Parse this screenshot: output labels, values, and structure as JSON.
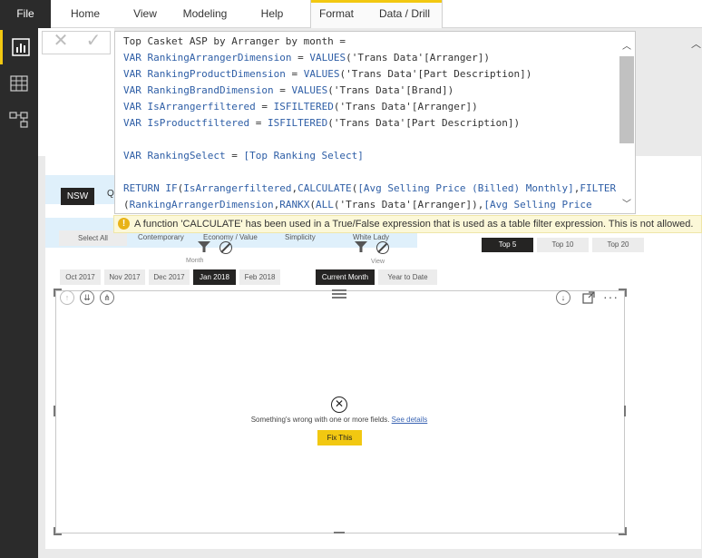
{
  "ribbon": {
    "file": "File",
    "tabs": [
      "Home",
      "View",
      "Modeling",
      "Help",
      "Format",
      "Data / Drill"
    ]
  },
  "formula": {
    "lines": [
      [
        {
          "t": "Top Casket ASP by Arranger by month =",
          "c": "plain"
        }
      ],
      [
        {
          "t": "VAR ",
          "c": "kw"
        },
        {
          "t": "RankingArrangerDimension",
          "c": "kw"
        },
        {
          "t": " = ",
          "c": "plain"
        },
        {
          "t": "VALUES",
          "c": "kw"
        },
        {
          "t": "('Trans Data'[Arranger])",
          "c": "plain"
        }
      ],
      [
        {
          "t": "VAR ",
          "c": "kw"
        },
        {
          "t": "RankingProductDimension",
          "c": "kw"
        },
        {
          "t": " = ",
          "c": "plain"
        },
        {
          "t": "VALUES",
          "c": "kw"
        },
        {
          "t": "('Trans Data'[Part Description])",
          "c": "plain"
        }
      ],
      [
        {
          "t": "VAR ",
          "c": "kw"
        },
        {
          "t": "RankingBrandDimension",
          "c": "kw"
        },
        {
          "t": " = ",
          "c": "plain"
        },
        {
          "t": "VALUES",
          "c": "kw"
        },
        {
          "t": "('Trans Data'[Brand])",
          "c": "plain"
        }
      ],
      [
        {
          "t": "VAR ",
          "c": "kw"
        },
        {
          "t": "IsArrangerfiltered",
          "c": "kw"
        },
        {
          "t": " = ",
          "c": "plain"
        },
        {
          "t": "ISFILTERED",
          "c": "kw"
        },
        {
          "t": "('Trans Data'[Arranger])",
          "c": "plain"
        }
      ],
      [
        {
          "t": "VAR ",
          "c": "kw"
        },
        {
          "t": "IsProductfiltered",
          "c": "kw"
        },
        {
          "t": " = ",
          "c": "plain"
        },
        {
          "t": "ISFILTERED",
          "c": "kw"
        },
        {
          "t": "('Trans Data'[Part Description])",
          "c": "plain"
        }
      ],
      [],
      [
        {
          "t": "VAR ",
          "c": "kw"
        },
        {
          "t": "RankingSelect",
          "c": "kw"
        },
        {
          "t": " = ",
          "c": "plain"
        },
        {
          "t": "[Top Ranking Select]",
          "c": "kw"
        }
      ],
      [],
      [
        {
          "t": "RETURN ",
          "c": "kw"
        },
        {
          "t": "IF",
          "c": "kw"
        },
        {
          "t": "(",
          "c": "plain"
        },
        {
          "t": "IsArrangerfiltered",
          "c": "kw"
        },
        {
          "t": ",",
          "c": "plain"
        },
        {
          "t": "CALCULATE",
          "c": "kw"
        },
        {
          "t": "(",
          "c": "plain"
        },
        {
          "t": "[Avg Selling Price (Billed) Monthly]",
          "c": "kw"
        },
        {
          "t": ",",
          "c": "plain"
        },
        {
          "t": "FILTER",
          "c": "kw"
        }
      ],
      [
        {
          "t": "(",
          "c": "plain"
        },
        {
          "t": "RankingArrangerDimension",
          "c": "kw"
        },
        {
          "t": ",",
          "c": "plain"
        },
        {
          "t": "RANKX",
          "c": "kw"
        },
        {
          "t": "(",
          "c": "plain"
        },
        {
          "t": "ALL",
          "c": "kw"
        },
        {
          "t": "('Trans Data'[Arranger]),",
          "c": "plain"
        },
        {
          "t": "[Avg Selling Price",
          "c": "kw"
        }
      ]
    ],
    "error": "A function 'CALCULATE' has been used in a True/False expression that is used as a table filter expression. This is not allowed."
  },
  "report": {
    "state": "NSW",
    "state_cut": "Q",
    "segments": [
      "Select All",
      "Contemporary",
      "Economy / Value",
      "Simplicity",
      "White Lady"
    ],
    "month_label": "Month",
    "months": [
      "Oct 2017",
      "Nov 2017",
      "Dec 2017",
      "Jan 2018",
      "Feb 2018"
    ],
    "selected_month": "Jan 2018",
    "view_label": "View",
    "views": [
      "Current Month",
      "Year to Date"
    ],
    "top_options": [
      "Top 5",
      "Top 10",
      "Top 20"
    ],
    "visual_error": "Something's wrong with one or more fields.",
    "see_details": "See details",
    "fix_this": "Fix This"
  },
  "colors": {
    "accent": "#f2c811",
    "dark": "#252423",
    "keyword": "#2e5ea6"
  }
}
